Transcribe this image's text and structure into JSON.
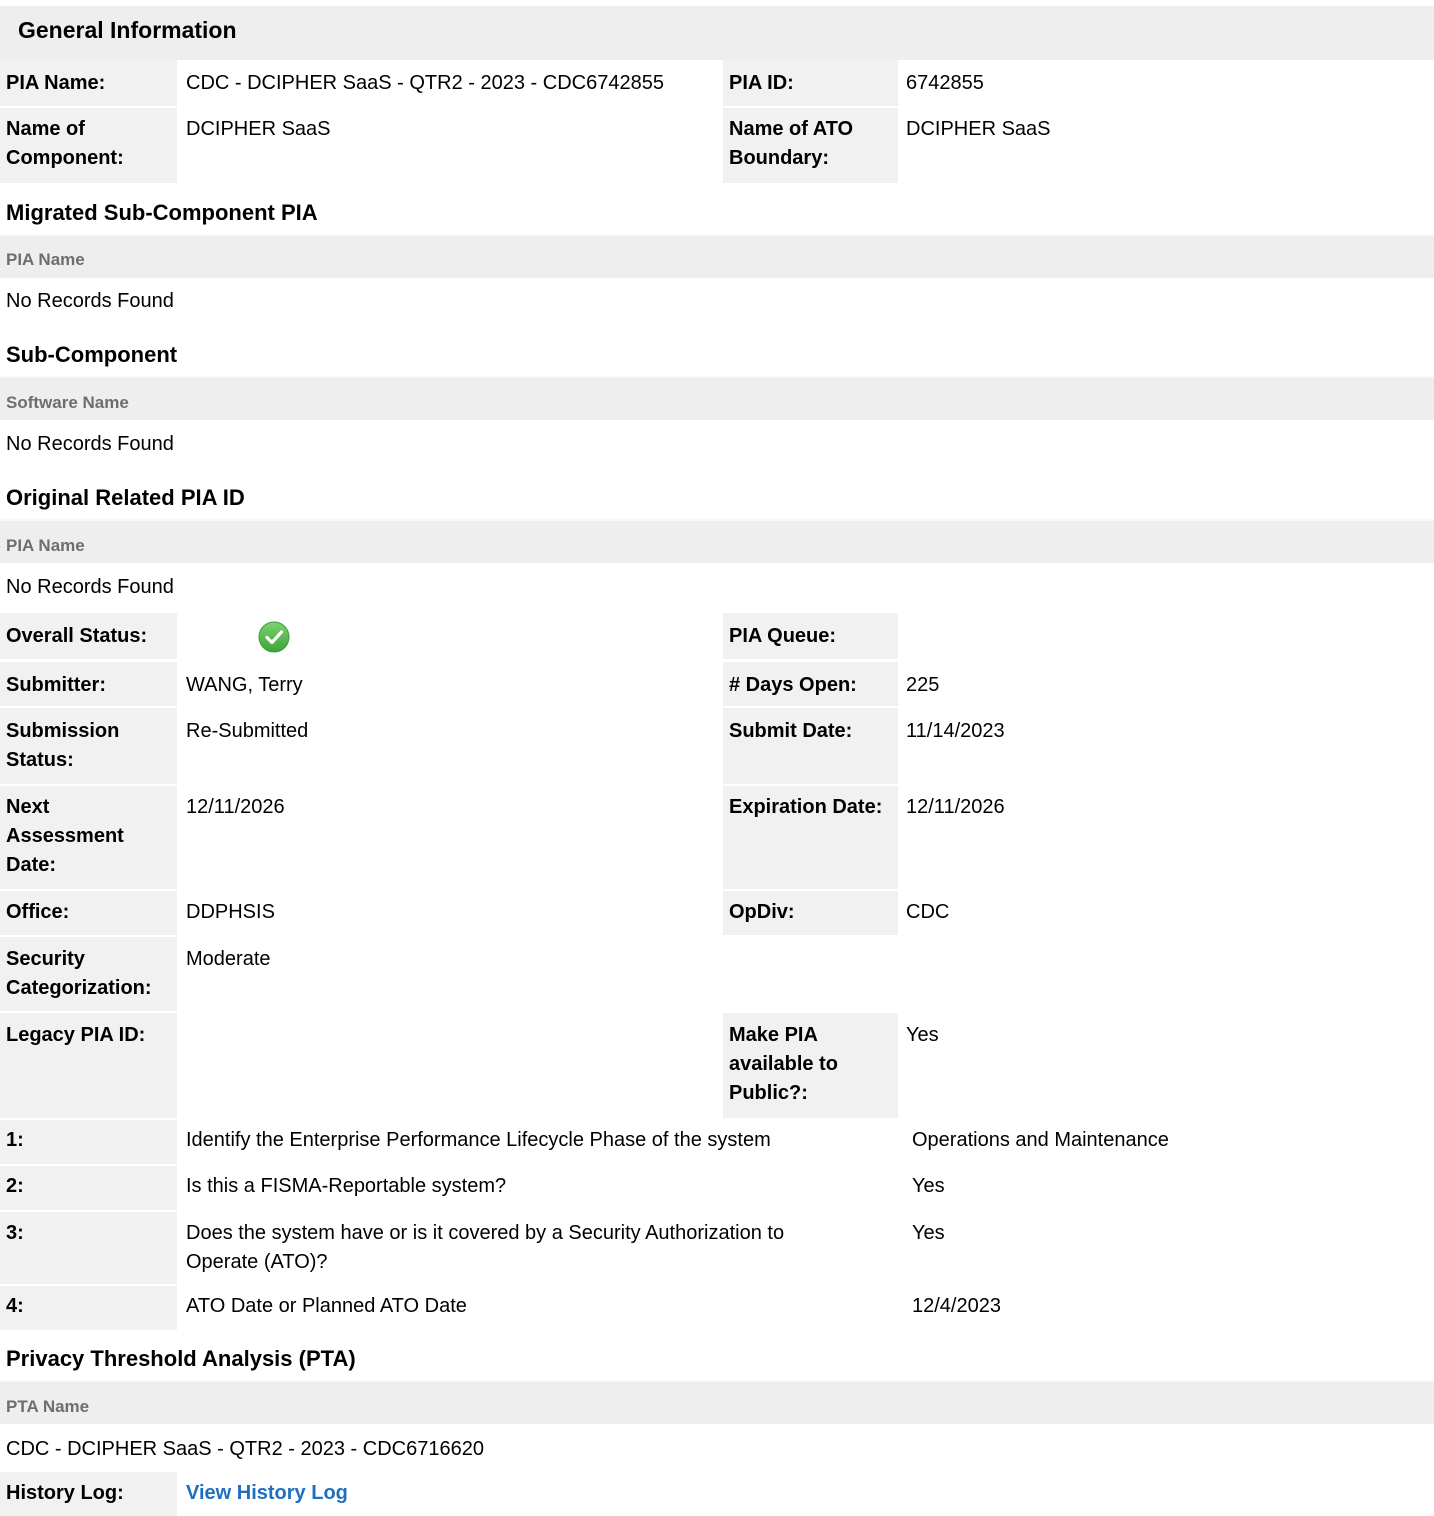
{
  "general": {
    "title": "General Information",
    "pia_name_label": "PIA Name:",
    "pia_name": "CDC - DCIPHER SaaS - QTR2 - 2023 - CDC6742855",
    "pia_id_label": "PIA ID:",
    "pia_id": "6742855",
    "component_label_1": "Name of",
    "component_label_2": "Component:",
    "component": "DCIPHER SaaS",
    "ato_label_1": "Name of ATO",
    "ato_label_2": "Boundary:",
    "ato_boundary": "DCIPHER SaaS"
  },
  "migrated": {
    "title": "Migrated Sub-Component PIA",
    "column": "PIA Name",
    "empty": "No Records Found"
  },
  "subcomponent": {
    "title": "Sub-Component",
    "column": "Software Name",
    "empty": "No Records Found"
  },
  "original": {
    "title": "Original Related PIA ID",
    "column": "PIA Name",
    "empty": "No Records Found"
  },
  "status": {
    "overall_label": "Overall Status:",
    "overall_icon": "check-circle-icon",
    "overall_color": "#4caf50",
    "queue_label": "PIA Queue:",
    "queue": "",
    "submitter_label": "Submitter:",
    "submitter": "WANG, Terry",
    "days_open_label": "# Days Open:",
    "days_open": "225",
    "submission_label_1": "Submission",
    "submission_label_2": "Status:",
    "submission_status": "Re-Submitted",
    "submit_date_label": "Submit Date:",
    "submit_date": "11/14/2023",
    "next_label_1": "Next",
    "next_label_2": "Assessment",
    "next_label_3": "Date:",
    "next_assessment": "12/11/2026",
    "expiration_label": "Expiration Date:",
    "expiration": "12/11/2026",
    "office_label": "Office:",
    "office": "DDPHSIS",
    "opdiv_label": "OpDiv:",
    "opdiv": "CDC",
    "security_label_1": "Security",
    "security_label_2": "Categorization:",
    "security": "Moderate",
    "legacy_label": "Legacy PIA ID:",
    "legacy": "",
    "public_label_1": "Make PIA",
    "public_label_2": "available to",
    "public_label_3": "Public?:",
    "public": "Yes"
  },
  "questions": [
    {
      "num": "1:",
      "q1": "Identify the Enterprise Performance Lifecycle Phase of the system",
      "q2": "",
      "answer": "Operations and Maintenance"
    },
    {
      "num": "2:",
      "q1": "Is this a FISMA-Reportable system?",
      "q2": "",
      "answer": "Yes"
    },
    {
      "num": "3:",
      "q1": "Does the system have or is it covered by a Security Authorization to",
      "q2": "Operate (ATO)?",
      "answer": "Yes"
    },
    {
      "num": "4:",
      "q1": "ATO Date or Planned ATO Date",
      "q2": "",
      "answer": "12/4/2023"
    }
  ],
  "pta": {
    "title": "Privacy Threshold Analysis (PTA)",
    "column": "PTA Name",
    "name": "CDC - DCIPHER SaaS - QTR2 - 2023 - CDC6716620"
  },
  "history": {
    "label": "History Log:",
    "link": "View History Log"
  }
}
